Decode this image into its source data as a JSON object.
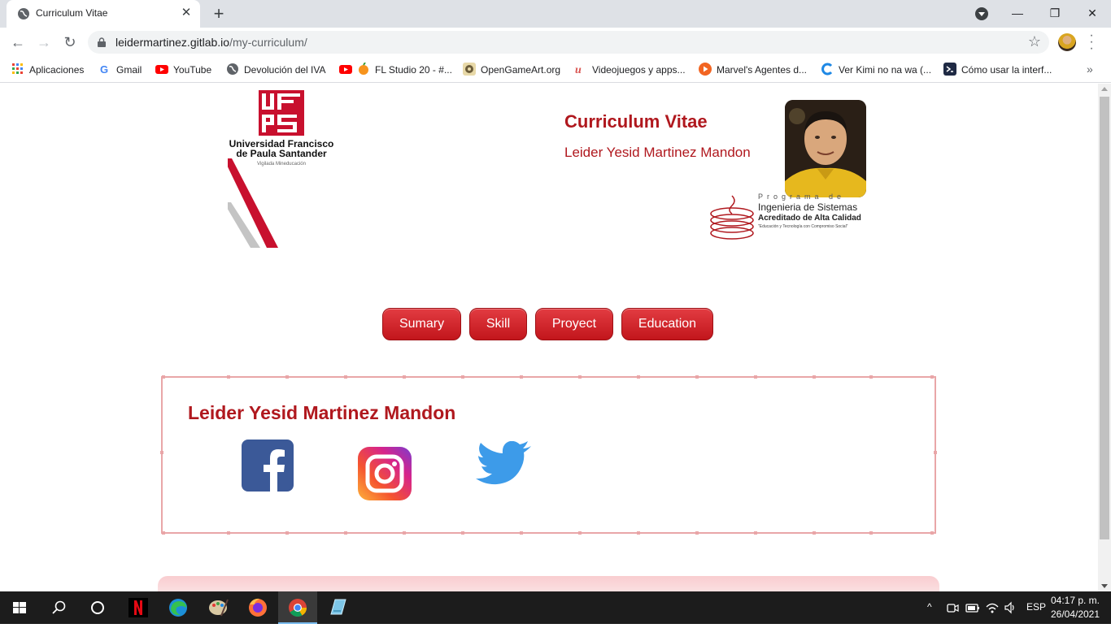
{
  "browser": {
    "tab_title": "Curriculum Vitae",
    "tab_close": "✕",
    "new_tab": "+",
    "url_host": "leidermartinez.gitlab.io",
    "url_path": "/my-curriculum/",
    "minimize": "—",
    "restore": "❐",
    "close": "✕",
    "back": "←",
    "forward": "→",
    "reload": "↻",
    "star": "☆",
    "bookmarks": [
      {
        "label": "Aplicaciones",
        "icon": "apps-grid-icon",
        "color": "#4285f4"
      },
      {
        "label": "Gmail",
        "icon": "google-icon",
        "color": "#ea4335"
      },
      {
        "label": "YouTube",
        "icon": "youtube-icon",
        "color": "#ff0000"
      },
      {
        "label": "Devolución del IVA",
        "icon": "globe-icon",
        "color": "#5f6368"
      },
      {
        "label": "FL Studio 20 - #...",
        "icon": "fl-studio-icon",
        "color": "#f7941d"
      },
      {
        "label": "OpenGameArt.org",
        "icon": "opengameart-icon",
        "color": "#6b8e23"
      },
      {
        "label": "Videojuegos y apps...",
        "icon": "u-icon",
        "color": "#d9534f"
      },
      {
        "label": "Marvel's Agentes d...",
        "icon": "play-icon",
        "color": "#f26522"
      },
      {
        "label": "Ver Kimi no na wa (...",
        "icon": "c-icon",
        "color": "#1e88e5"
      },
      {
        "label": "Cómo usar la interf...",
        "icon": "vscode-icon",
        "color": "#1f2a44"
      }
    ],
    "more": "»"
  },
  "page": {
    "university_name_line1": "Universidad Francisco",
    "university_name_line2": "de Paula Santander",
    "university_sub": "Vigilada Mineducación",
    "cv_title": "Curriculum Vitae",
    "person_name": "Leider Yesid Martinez Mandon",
    "program_line1": "Programa de",
    "program_line2": "Ingenieria de Sistemas",
    "program_line3": "Acreditado de Alta Calidad",
    "program_line4": "\"Educación y Tecnología con Compromiso Social\"",
    "nav": [
      "Sumary",
      "Skill",
      "Proyect",
      "Education"
    ],
    "card_name": "Leider Yesid Martinez Mandon",
    "social": [
      "facebook-icon",
      "instagram-icon",
      "twitter-icon"
    ]
  },
  "taskbar": {
    "lang": "ESP",
    "time": "04:17 p. m.",
    "date": "26/04/2021"
  },
  "colors": {
    "accent": "#b0181e",
    "button": "#d42a30",
    "card_border": "#e9a6a8"
  }
}
